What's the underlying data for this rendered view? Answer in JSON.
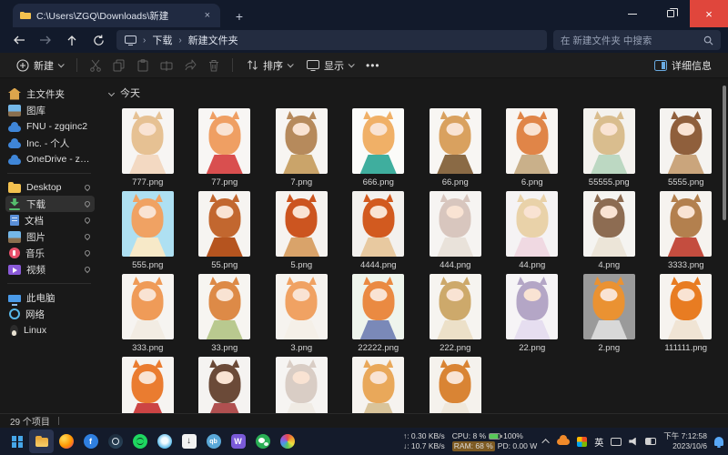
{
  "window": {
    "tab_title": "C:\\Users\\ZGQ\\Downloads\\新建",
    "icons": {
      "new_tab": "+",
      "tab_close": "×",
      "win_close": "×"
    }
  },
  "nav": {
    "breadcrumb": [
      "下载",
      "新建文件夹"
    ],
    "crumb_sep": "›",
    "search_placeholder": "在 新建文件夹 中搜索"
  },
  "toolbar": {
    "new_label": "新建",
    "sort_label": "排序",
    "view_label": "显示",
    "more_label": "•••",
    "details_label": "详细信息"
  },
  "sidebar": {
    "top_items": [
      {
        "label": "主文件夹",
        "icon": "home"
      },
      {
        "label": "图库",
        "icon": "gallery"
      },
      {
        "label": "FNU - zgqinc2",
        "icon": "cloud"
      },
      {
        "label": "Inc. - 个人",
        "icon": "cloud"
      },
      {
        "label": "OneDrive - zgqinc",
        "icon": "cloud"
      }
    ],
    "quick_items": [
      {
        "label": "Desktop",
        "icon": "folder",
        "pinned": true
      },
      {
        "label": "下载",
        "icon": "downloads",
        "pinned": true,
        "selected": true
      },
      {
        "label": "文档",
        "icon": "documents",
        "pinned": true
      },
      {
        "label": "图片",
        "icon": "pictures",
        "pinned": true
      },
      {
        "label": "音乐",
        "icon": "music",
        "pinned": true
      },
      {
        "label": "视频",
        "icon": "videos",
        "pinned": true
      }
    ],
    "bottom_items": [
      {
        "label": "此电脑",
        "icon": "pc"
      },
      {
        "label": "网络",
        "icon": "network"
      },
      {
        "label": "Linux",
        "icon": "linux"
      }
    ]
  },
  "content": {
    "group_label": "今天",
    "files": [
      {
        "name": "777.png",
        "bg": "#f7f5f3",
        "hair": "#e6c193",
        "dress": "#f3d9c2"
      },
      {
        "name": "77.png",
        "bg": "#f8f6f4",
        "hair": "#ef9f63",
        "dress": "#d94f4f"
      },
      {
        "name": "7.png",
        "bg": "#f7f5f2",
        "hair": "#b68a5c",
        "dress": "#caa46a"
      },
      {
        "name": "666.png",
        "bg": "#fbfbf9",
        "hair": "#f0b067",
        "dress": "#3fae9e"
      },
      {
        "name": "66.png",
        "bg": "#f8f6f3",
        "hair": "#d9a15f",
        "dress": "#8a6a45"
      },
      {
        "name": "6.png",
        "bg": "#f8f5f2",
        "hair": "#e08548",
        "dress": "#c9b08a"
      },
      {
        "name": "55555.png",
        "bg": "#f4f2ee",
        "hair": "#d9bd8e",
        "dress": "#bcd8c2"
      },
      {
        "name": "5555.png",
        "bg": "#f5f3f0",
        "hair": "#8f5f3c",
        "dress": "#caa57c"
      },
      {
        "name": "555.png",
        "bg": "#aee0f2",
        "hair": "#f0a263",
        "dress": "#f7e9c8"
      },
      {
        "name": "55.png",
        "bg": "#f6f4f1",
        "hair": "#c2672f",
        "dress": "#b5541f"
      },
      {
        "name": "5.png",
        "bg": "#f6f3f0",
        "hair": "#cc5520",
        "dress": "#d9a36a"
      },
      {
        "name": "4444.png",
        "bg": "#f3f1ee",
        "hair": "#d25a1f",
        "dress": "#e8c9a0"
      },
      {
        "name": "444.png",
        "bg": "#f6f4f2",
        "hair": "#d8c6be",
        "dress": "#e9e2da"
      },
      {
        "name": "44.png",
        "bg": "#f5f3f4",
        "hair": "#e9d2a9",
        "dress": "#f0d9e2"
      },
      {
        "name": "4.png",
        "bg": "#f5f4f1",
        "hair": "#8d6c52",
        "dress": "#ece5d8"
      },
      {
        "name": "3333.png",
        "bg": "#f6f3ef",
        "hair": "#b3804e",
        "dress": "#c44d3f"
      },
      {
        "name": "333.png",
        "bg": "#f6f4f1",
        "hair": "#ef9b58",
        "dress": "#f2ece3"
      },
      {
        "name": "33.png",
        "bg": "#f7f5f1",
        "hair": "#dd8a47",
        "dress": "#b9c98f"
      },
      {
        "name": "3.png",
        "bg": "#f6f3ef",
        "hair": "#f0a263",
        "dress": "#f5f0e8"
      },
      {
        "name": "22222.png",
        "bg": "#eef4ec",
        "hair": "#ea8a42",
        "dress": "#7a89b8"
      },
      {
        "name": "222.png",
        "bg": "#f6f4f0",
        "hair": "#cda96b",
        "dress": "#ece0c8"
      },
      {
        "name": "22.png",
        "bg": "#f6f4f6",
        "hair": "#b4a6c6",
        "dress": "#e6def0"
      },
      {
        "name": "2.png",
        "bg": "#9a9a9a",
        "hair": "#ea9232",
        "dress": "#d8d8d8"
      },
      {
        "name": "111111.png",
        "bg": "#f6f3ef",
        "hair": "#e87c22",
        "dress": "#f0e4d4"
      },
      {
        "name": "",
        "bg": "#f6f4f1",
        "hair": "#ea7c30",
        "dress": "#cc4444"
      },
      {
        "name": "",
        "bg": "#f5f3f1",
        "hair": "#6b4a38",
        "dress": "#b05050"
      },
      {
        "name": "",
        "bg": "#f6f4f2",
        "hair": "#d9cdc5",
        "dress": "#f0ebe4"
      },
      {
        "name": "",
        "bg": "#f6f3ef",
        "hair": "#e9a85a",
        "dress": "#d9c49a"
      },
      {
        "name": "",
        "bg": "#f5f2ed",
        "hair": "#d98434",
        "dress": "#efe8dc"
      }
    ]
  },
  "statusbar": {
    "items_count": "29 个项目"
  },
  "taskbar": {
    "apps": [
      {
        "icon": "start"
      },
      {
        "icon": "explorer",
        "active": true
      },
      {
        "icon": "firefox"
      },
      {
        "icon": "fdm",
        "glyph": "f"
      },
      {
        "icon": "steam"
      },
      {
        "icon": "spotify"
      },
      {
        "icon": "quark"
      },
      {
        "icon": "downloader",
        "glyph": "↓"
      },
      {
        "icon": "qbittorrent",
        "glyph": "qb"
      },
      {
        "icon": "wapp",
        "glyph": "W"
      },
      {
        "icon": "wechat"
      },
      {
        "icon": "paint"
      }
    ],
    "tray": {
      "up_speed": "↑: 0.30 KB/s",
      "down_speed": "↓: 10.7 KB/s",
      "cpu": "CPU: 8 %",
      "ram": "RAM: 68 %",
      "battery_pct": "100%",
      "power_draw": "PD: 0.00 W",
      "ime": "英",
      "time": "下午 7:12:58",
      "date": "2023/10/6"
    }
  }
}
